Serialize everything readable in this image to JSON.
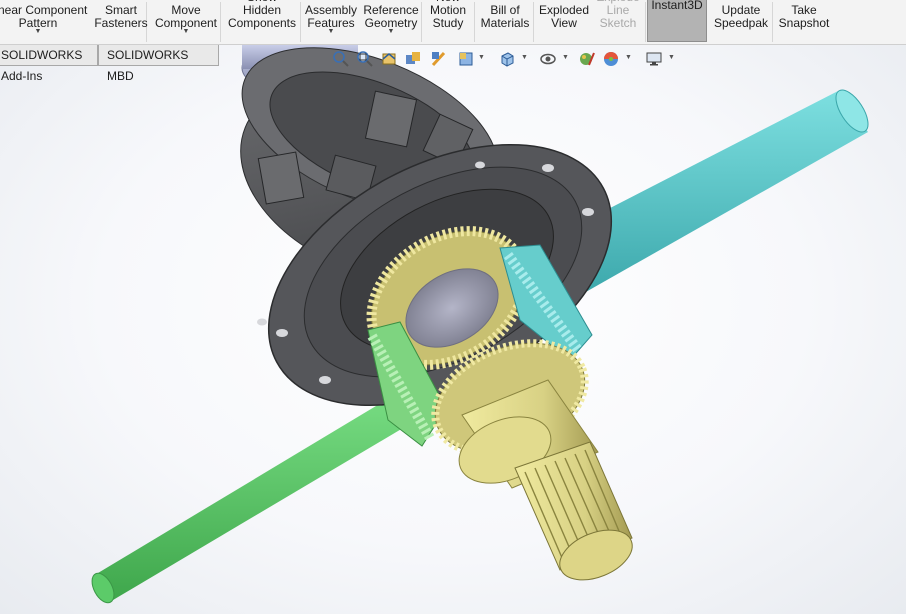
{
  "ribbon": {
    "buttons": [
      {
        "label": "Linear Component\nPattern",
        "state": "normal",
        "dropdown": true
      },
      {
        "label": "Smart\nFasteners",
        "state": "normal",
        "dropdown": false
      },
      {
        "label": "Move\nComponent",
        "state": "normal",
        "dropdown": true
      },
      {
        "label": "Show\nHidden\nComponents",
        "state": "normal",
        "dropdown": false
      },
      {
        "label": "Assembly\nFeatures",
        "state": "normal",
        "dropdown": true
      },
      {
        "label": "Reference\nGeometry",
        "state": "normal",
        "dropdown": true
      },
      {
        "label": "New\nMotion\nStudy",
        "state": "normal",
        "dropdown": false
      },
      {
        "label": "Bill of\nMaterials",
        "state": "normal",
        "dropdown": false
      },
      {
        "label": "Exploded\nView",
        "state": "normal",
        "dropdown": false
      },
      {
        "label": "Explode\nLine\nSketch",
        "state": "disabled",
        "dropdown": false
      },
      {
        "label": "Instant3D",
        "state": "active",
        "dropdown": false
      },
      {
        "label": "Update\nSpeedpak",
        "state": "normal",
        "dropdown": false
      },
      {
        "label": "Take\nSnapshot",
        "state": "normal",
        "dropdown": false
      }
    ]
  },
  "tabs": [
    {
      "label": "SOLIDWORKS Add-Ins"
    },
    {
      "label": "SOLIDWORKS MBD"
    }
  ],
  "heads_up_toolbar": {
    "icons": [
      "zoom-to-fit-icon",
      "zoom-to-area-icon",
      "previous-view-icon",
      "section-view-icon",
      "dynamic-annotation-icon",
      "view-orientation-icon",
      "display-style-icon",
      "hide-show-items-icon",
      "edit-appearance-icon",
      "apply-scene-icon",
      "view-settings-icon"
    ]
  },
  "colors": {
    "ribbon_bg": "#f3f3f3",
    "housing": "#5a5b5e",
    "housing_dark": "#3f4043",
    "gear_gold": "#e3dc92",
    "gear_gold_dark": "#a9a15a",
    "shaft_green": "#5fcf6c",
    "shaft_cyan": "#52c3c6",
    "gear_green": "#8ad88a",
    "gear_cyan": "#6fd0cf"
  }
}
